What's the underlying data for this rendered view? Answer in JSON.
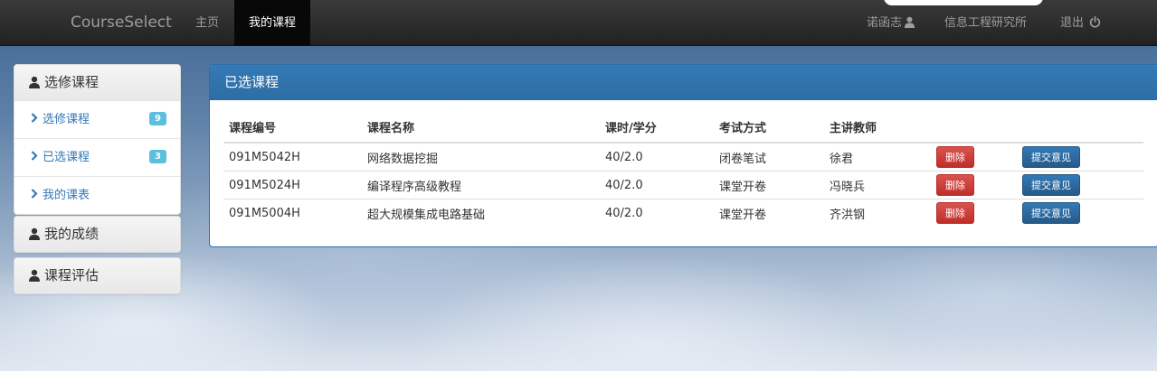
{
  "navbar": {
    "brand": "CourseSelect",
    "home": "主页",
    "my_courses": "我的课程",
    "user": "诺函志",
    "department": "信息工程研究所",
    "logout": "退出"
  },
  "sidebar": {
    "panels": [
      {
        "heading": "选修课程",
        "items": [
          {
            "label": "选修课程",
            "badge": "9"
          },
          {
            "label": "已选课程",
            "badge": "3"
          },
          {
            "label": "我的课表"
          }
        ]
      },
      {
        "heading": "我的成绩"
      },
      {
        "heading": "课程评估"
      }
    ]
  },
  "main": {
    "title": "已选课程",
    "columns": [
      "课程编号",
      "课程名称",
      "课时/学分",
      "考试方式",
      "主讲教师"
    ],
    "rows": [
      {
        "code": "091M5042H",
        "name": "网络数据挖掘",
        "hours": "40/2.0",
        "exam": "闭卷笔试",
        "teacher": "徐君"
      },
      {
        "code": "091M5024H",
        "name": "编译程序高级教程",
        "hours": "40/2.0",
        "exam": "课堂开卷",
        "teacher": "冯晓兵"
      },
      {
        "code": "091M5004H",
        "name": "超大规模集成电路基础",
        "hours": "40/2.0",
        "exam": "课堂开卷",
        "teacher": "齐洪钢"
      }
    ],
    "delete_label": "删除",
    "feedback_label": "提交意见"
  },
  "colors": {
    "primary": "#337ab7",
    "danger": "#d9534f",
    "badge": "#5bc0de",
    "navbar": "#222222"
  }
}
